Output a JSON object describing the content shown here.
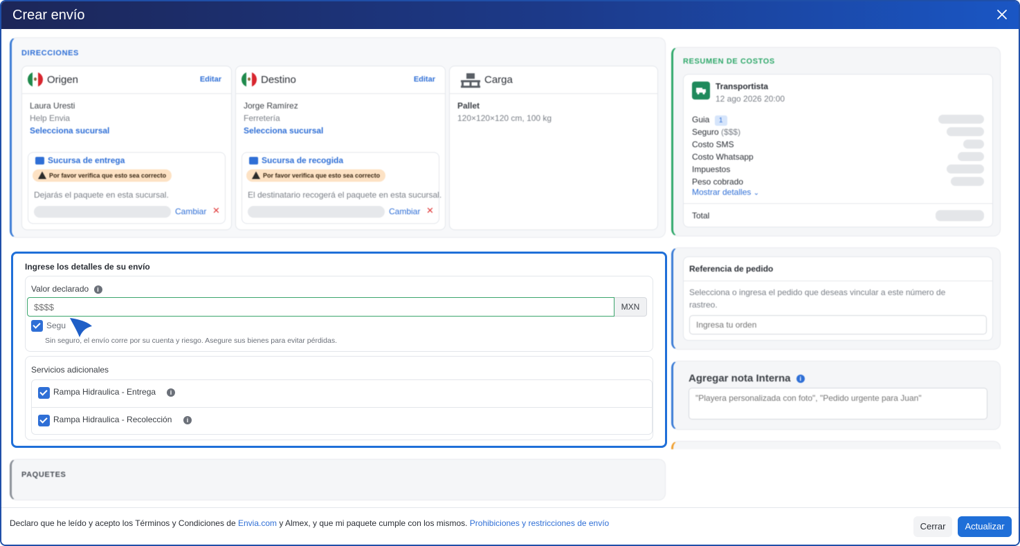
{
  "modal": {
    "title": "Crear envío"
  },
  "direcciones": {
    "label": "DIRECCIONES",
    "origen": {
      "title": "Origen",
      "edit": "Editar",
      "name": "Laura Uresti",
      "company": "Help Envia",
      "select_link": "Selecciona sucursal",
      "branch_title": "Sucursa de entrega",
      "warning": "Por favor verifica que esto sea correcto",
      "branch_desc": "Dejarás el paquete en esta sucursal.",
      "change": "Cambiar"
    },
    "destino": {
      "title": "Destino",
      "edit": "Editar",
      "name": "Jorge Ramírez",
      "company": "Ferretería",
      "select_link": "Selecciona sucursal",
      "branch_title": "Sucursa de recogida",
      "warning": "Por favor verifica que esto sea correcto",
      "branch_desc": "El destinatario recogerá el paquete en esta sucursal.",
      "change": "Cambiar"
    },
    "carga": {
      "title": "Carga",
      "type": "Pallet",
      "dims": "120×120×120 cm, 100 kg"
    }
  },
  "details": {
    "heading": "Ingrese los detalles de su envío",
    "declared_label": "Valor declarado",
    "declared_placeholder": "$$$$",
    "currency": "MXN",
    "insurance_label": "Segu",
    "insurance_note": "Sin seguro, el envío corre por su cuenta y riesgo. Asegure sus bienes para evitar pérdidas.",
    "services_label": "Servicios adicionales",
    "services": [
      {
        "label": "Rampa Hidraulica - Entrega",
        "checked": true
      },
      {
        "label": "Rampa Hidraulica - Recolección",
        "checked": true
      }
    ]
  },
  "paquetes": {
    "label": "PAQUETES"
  },
  "resumen": {
    "label": "RESUMEN DE COSTOS",
    "carrier": "Transportista",
    "date": "12 ago 2026 20:00",
    "guia": "Guia",
    "guia_count": "1",
    "seguro": "Seguro",
    "seguro_hint": "($$$)",
    "sms": "Costo SMS",
    "whatsapp": "Costo Whatsapp",
    "impuestos": "Impuestos",
    "peso": "Peso cobrado",
    "show_details": "Mostrar detalles",
    "total": "Total"
  },
  "referencia": {
    "title": "Referencia de pedido",
    "desc_1": "Selecciona o ingresa el pedido que deseas vincular a este número de",
    "desc_2": "rastreo.",
    "placeholder": "Ingresa tu orden"
  },
  "nota": {
    "title": "Agregar nota Interna",
    "placeholder": "\"Playera personalizada con foto\", \"Pedido urgente para Juan\""
  },
  "footer": {
    "text_1": "Declaro que he leído y acepto los Términos y Condiciones de ",
    "link_1": "Envia.com",
    "text_2": " y Almex, y que mi paquete cumple con los mismos. ",
    "link_2": "Prohibiciones y restricciones de envío",
    "cerrar": "Cerrar",
    "actualizar": "Actualizar"
  },
  "colors": {
    "primary": "#1f6fd8",
    "accent_green": "#2fa86a",
    "warning_bg": "#fde2c4",
    "danger": "#e03a3a"
  }
}
